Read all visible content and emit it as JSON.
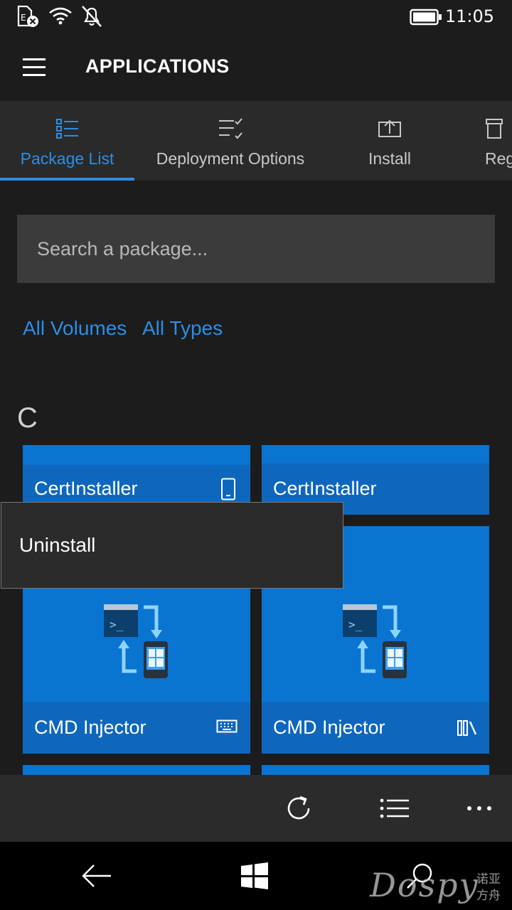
{
  "status": {
    "time": "11:05"
  },
  "header": {
    "title": "APPLICATIONS"
  },
  "tabs": [
    {
      "label": "Package List",
      "active": true
    },
    {
      "label": "Deployment Options",
      "active": false
    },
    {
      "label": "Install",
      "active": false
    },
    {
      "label": "Reg",
      "active": false
    }
  ],
  "search": {
    "placeholder": "Search a package..."
  },
  "filters": {
    "volumes": "All Volumes",
    "types": "All Types"
  },
  "group_letter": "C",
  "tiles": [
    {
      "name": "CertInstaller",
      "icon": "phone-icon"
    },
    {
      "name": "CertInstaller",
      "icon": ""
    },
    {
      "name": "CMD Injector",
      "icon": "keyboard-icon"
    },
    {
      "name": "CMD Injector",
      "icon": "library-icon"
    }
  ],
  "context_menu": {
    "uninstall": "Uninstall"
  },
  "watermark": {
    "brand": "Dospy",
    "cn": "诺亚方舟"
  },
  "colors": {
    "accent": "#2b8ee6",
    "tile": "#0a74d1",
    "tile_band": "#0f67bd"
  }
}
